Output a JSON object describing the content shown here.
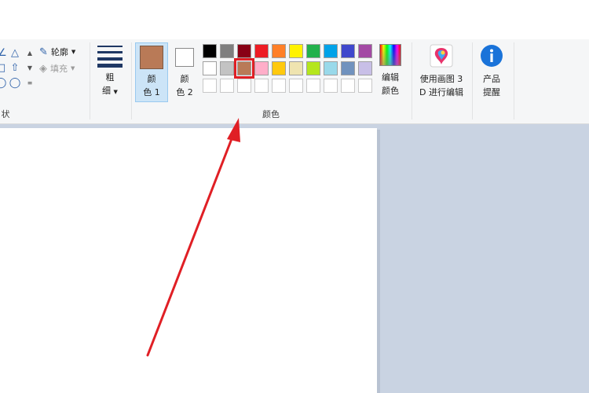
{
  "shapes_group": {
    "outline_label": "轮廓",
    "fill_label": "填充",
    "group_label": "状",
    "shape_glyphs": [
      "◸",
      "△",
      "□",
      "⇧",
      "◯",
      "◯"
    ]
  },
  "size_button": {
    "label_line1": "粗",
    "label_line2": "细"
  },
  "colors_group": {
    "color1_line1": "颜",
    "color1_line2": "色 1",
    "color2_line1": "颜",
    "color2_line2": "色 2",
    "edit_line1": "编辑",
    "edit_line2": "颜色",
    "group_label": "颜色",
    "color1_value": "#b97a57",
    "color2_value": "#ffffff",
    "palette_row1": [
      "#000000",
      "#7f7f7f",
      "#880015",
      "#ed1c24",
      "#ff7f27",
      "#fff200",
      "#22b14c",
      "#00a2e8",
      "#3f48cc",
      "#a349a4"
    ],
    "palette_row2": [
      "#ffffff",
      "#c3c3c3",
      "#b97a57",
      "#ffaec9",
      "#ffc90e",
      "#efe4b0",
      "#b5e61d",
      "#99d9ea",
      "#7092be",
      "#c8bfe7"
    ],
    "palette_row3": [
      "",
      "",
      "",
      "",
      "",
      "",
      "",
      "",
      "",
      ""
    ]
  },
  "paint3d": {
    "line1": "使用画图 3",
    "line2": "D 进行编辑"
  },
  "product_alert": {
    "line1": "产品",
    "line2": "提醒"
  },
  "accent_colors": {
    "highlight": "#e01f25",
    "arrow": "#e01f25",
    "selected_bg": "#cce4f7"
  }
}
